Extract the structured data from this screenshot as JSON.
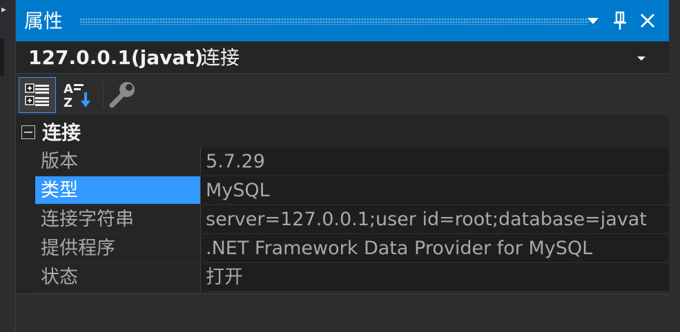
{
  "window": {
    "title": "属性"
  },
  "object_selector": {
    "name": "127.0.0.1(javat)",
    "type": "连接"
  },
  "toolbar": {
    "buttons": [
      {
        "icon": "categorized-icon",
        "active": true
      },
      {
        "icon": "alphabetical-icon",
        "active": false
      },
      {
        "icon": "property-pages-icon",
        "active": false
      }
    ]
  },
  "category": {
    "label": "连接",
    "expanded": true
  },
  "properties": [
    {
      "name": "版本",
      "value": "5.7.29",
      "selected": false
    },
    {
      "name": "类型",
      "value": "MySQL",
      "selected": true
    },
    {
      "name": "连接字符串",
      "value": "server=127.0.0.1;user id=root;database=javat",
      "selected": false
    },
    {
      "name": "提供程序",
      "value": ".NET Framework Data Provider for MySQL",
      "selected": false
    },
    {
      "name": "状态",
      "value": "打开",
      "selected": false
    }
  ],
  "colors": {
    "title_bar": "#007acc",
    "selection": "#3399ff",
    "background": "#252526"
  }
}
